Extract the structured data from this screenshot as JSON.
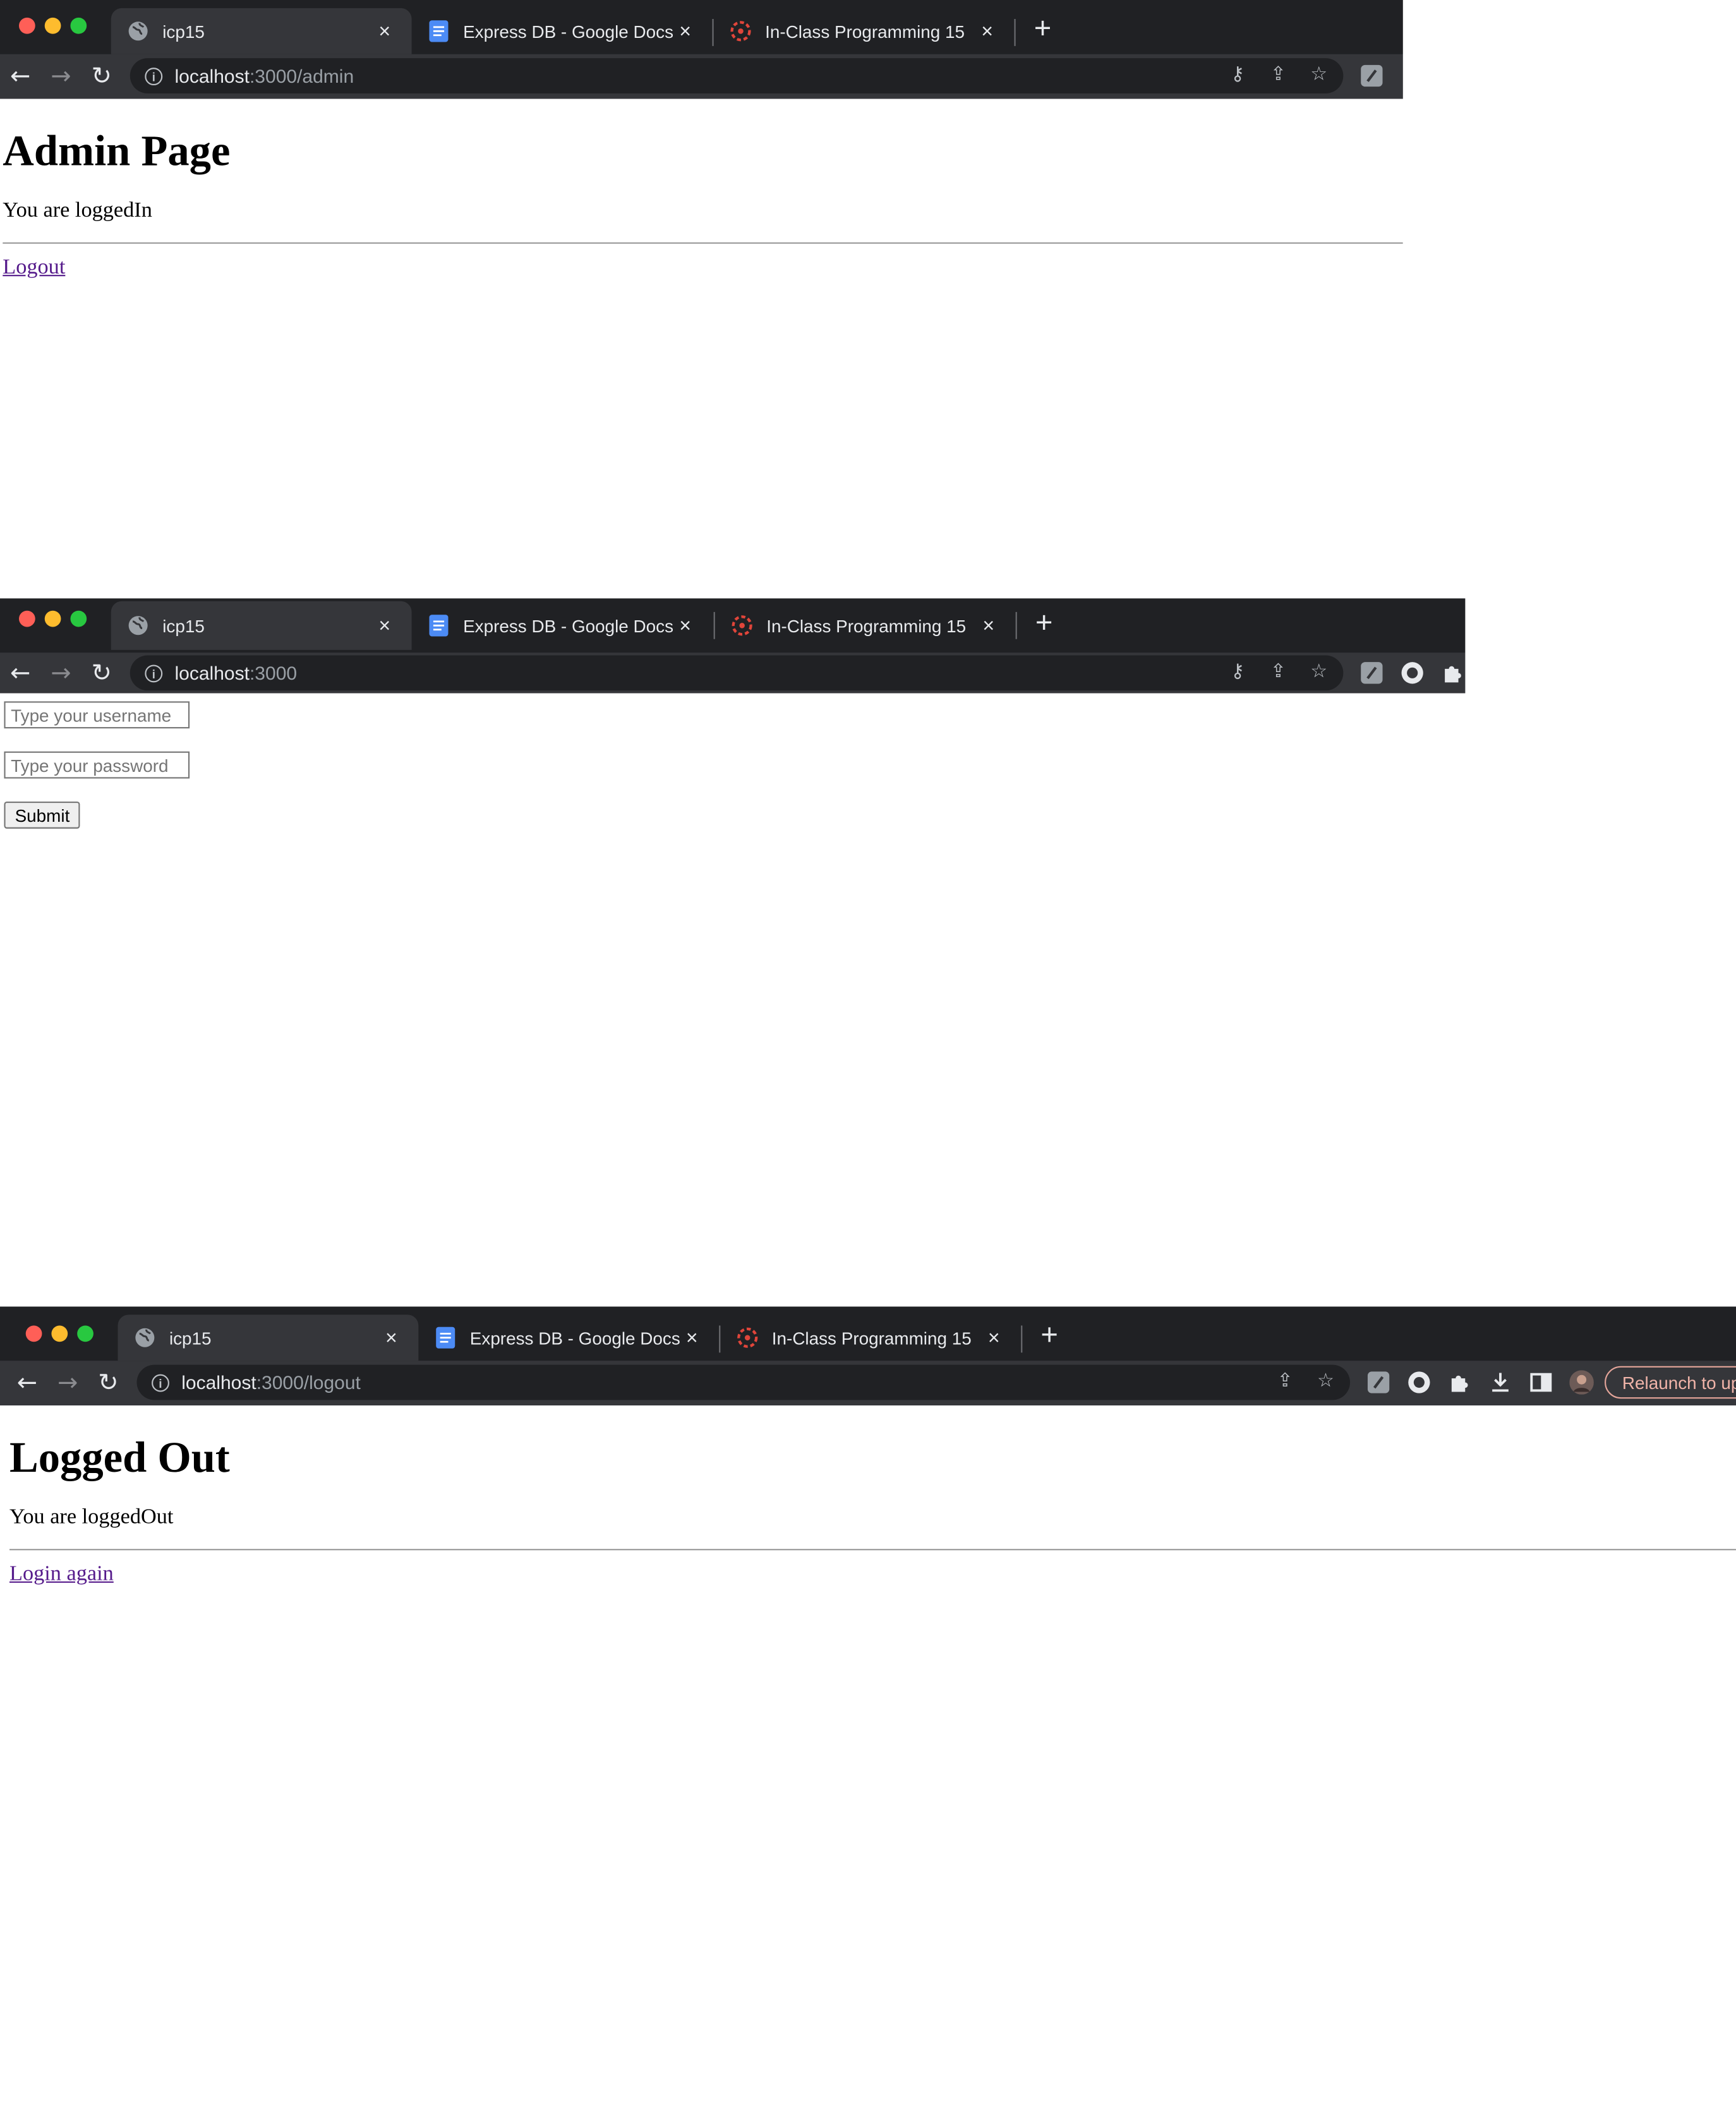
{
  "tabs": [
    {
      "title": "icp15"
    },
    {
      "title": "Express DB - Google Docs"
    },
    {
      "title": "In-Class Programming 15"
    }
  ],
  "new_tab_symbol": "+",
  "close_symbol": "×",
  "window1": {
    "url_host": "localhost",
    "url_path": ":3000/admin",
    "heading": "Admin Page",
    "message": "You are loggedIn",
    "link": "Logout"
  },
  "window2": {
    "url_host": "localhost",
    "url_path": ":3000",
    "username_placeholder": "Type your username",
    "password_placeholder": "Type your password",
    "submit": "Submit"
  },
  "window3": {
    "url_host": "localhost",
    "url_path": ":3000/logout",
    "heading": "Logged Out",
    "message": "You are loggedOut",
    "link": "Login again",
    "relaunch": "Relaunch to up"
  },
  "icons": {
    "favicon_tab1": "globe-icon",
    "favicon_tab2": "google-docs-icon",
    "favicon_tab3": "course-logo-icon",
    "toolbar": [
      "back-icon",
      "forward-icon",
      "reload-icon",
      "info-icon",
      "key-icon",
      "share-icon",
      "star-icon",
      "extension-icon",
      "puzzle-icon",
      "download-icon",
      "sidepanel-icon",
      "avatar"
    ]
  }
}
